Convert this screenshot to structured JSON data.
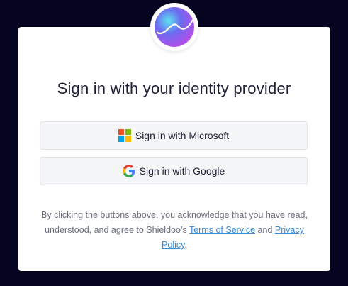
{
  "title": "Sign in with your identity provider",
  "buttons": {
    "microsoft_label": "Sign in with Microsoft",
    "google_label": "Sign in with Google"
  },
  "legal": {
    "text_before": "By clicking the buttons above, you acknowledge that you have read, understood, and agree to Shieldoo’s ",
    "terms_link": "Terms of Service",
    "text_middle": " and ",
    "privacy_link": "Privacy Policy",
    "text_after": "."
  },
  "icons": {
    "logo": "shieldoo-logo-icon",
    "microsoft": "microsoft-icon",
    "google": "google-icon"
  },
  "colors": {
    "background": "#050521",
    "card": "#ffffff",
    "link": "#3a8cd8",
    "microsoft_red": "#f25022",
    "microsoft_green": "#7fba00",
    "microsoft_blue": "#00a4ef",
    "microsoft_yellow": "#ffb900"
  }
}
